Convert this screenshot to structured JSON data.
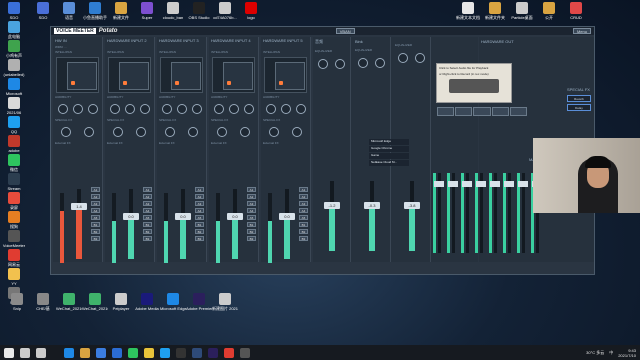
{
  "desktop": {
    "icons_left": [
      {
        "label": "SDO",
        "color": "#3a6fd8"
      },
      {
        "label": "此电脑",
        "color": "#4aa3df"
      },
      {
        "label": "小鸡有声",
        "color": "#3fa34d"
      },
      {
        "label": "(unlabelled)",
        "color": "#b0b0b0"
      },
      {
        "label": "Microsoft",
        "color": "#1e88e5"
      },
      {
        "label": "2021/06",
        "color": "#d9d9d9"
      },
      {
        "label": "QQ",
        "color": "#1ea0f0"
      },
      {
        "label": "adobe",
        "color": "#c0392b"
      },
      {
        "label": "微信",
        "color": "#2ec55f"
      },
      {
        "label": "Stream",
        "color": "#2c3e50"
      },
      {
        "label": "录屏",
        "color": "#e74c3c"
      },
      {
        "label": "搜狗",
        "color": "#e67e22"
      },
      {
        "label": "VoiceMeeter",
        "color": "#555"
      },
      {
        "label": "网易云",
        "color": "#e03c31"
      },
      {
        "label": "YY",
        "color": "#f2c14e"
      },
      {
        "label": "Snip",
        "color": "#777"
      }
    ],
    "icons_top": [
      {
        "label": "SDO",
        "color": "#4a6fd8"
      },
      {
        "label": "语音",
        "color": "#5a8ed8"
      },
      {
        "label": "小鱼直播助手",
        "color": "#2f7dd1"
      },
      {
        "label": "新建文件",
        "color": "#d9a441"
      },
      {
        "label": "Super",
        "color": "#7d4fd0"
      },
      {
        "label": "cloudc_ban",
        "color": "#ccc"
      },
      {
        "label": "OBS Studio",
        "color": "#222"
      },
      {
        "label": "cd74A076b...",
        "color": "#ccc"
      },
      {
        "label": "logo",
        "color": "#d00"
      }
    ],
    "icons_top_right": [
      {
        "label": "新建文本文档",
        "color": "#e6e6e6"
      },
      {
        "label": "新建文件夹",
        "color": "#d9a441"
      },
      {
        "label": "Particle桌面",
        "color": "#ccc"
      },
      {
        "label": "公开",
        "color": "#d9a441"
      },
      {
        "label": "CRUD",
        "color": "#e04848"
      }
    ],
    "icons_bottom": [
      {
        "label": "Snip",
        "color": "#8a8a8a"
      },
      {
        "label": "CHE/基",
        "color": "#888"
      },
      {
        "label": "WeChat_2021052",
        "color": "#3fb36b"
      },
      {
        "label": "WeChat_2021052",
        "color": "#3fb36b"
      },
      {
        "label": "Peiplayer",
        "color": "#ccc"
      },
      {
        "label": "Adobe Media",
        "color": "#1a1a7a"
      },
      {
        "label": "Microsoft Edge",
        "color": "#1e88e5"
      },
      {
        "label": "Adobe Premiere",
        "color": "#2b1f5c"
      },
      {
        "label": "新建图片 2021062",
        "color": "#ccc"
      }
    ]
  },
  "voicemeeter": {
    "logo": "VOICE MEETER",
    "brand": "Potato",
    "vban": "VBAN",
    "strips": [
      {
        "name": "HW IN",
        "sub": "WDM: ...",
        "fader": "1.4",
        "level": 0.75,
        "color": "#e9573c"
      },
      {
        "name": "HARDWARE INPUT 2",
        "sub": "",
        "fader": "0.0",
        "level": 0.6,
        "color": "#4fd6b0"
      },
      {
        "name": "HARDWARE INPUT 3",
        "sub": "",
        "fader": "0.0",
        "level": 0.6,
        "color": "#4fd6b0"
      },
      {
        "name": "HARDWARE INPUT 4",
        "sub": "",
        "fader": "0.0",
        "level": 0.6,
        "color": "#4fd6b0"
      },
      {
        "name": "HARDWARE INPUT 5",
        "sub": "",
        "fader": "0.0",
        "level": 0.6,
        "color": "#4fd6b0"
      }
    ],
    "intellipan_label": "INTELLIPAN",
    "color_panel": "Color Panel",
    "audibility_label": "AUDIBILITY",
    "comp_label": "Comp",
    "gate_label": "Gate",
    "special_fx": "SPECIAL FX",
    "external_fx": "External FX",
    "bus_buttons": [
      "A1",
      "A2",
      "A3",
      "A4",
      "A5",
      "B1",
      "B2",
      "B3"
    ],
    "virtual": [
      {
        "name": "音频",
        "fader": "-1.2"
      },
      {
        "name": "Bink",
        "fader": "-0.3"
      },
      {
        "name": "",
        "fader": "-3.8"
      }
    ],
    "equalizer": "EQUALIZER",
    "ext_fx_list": [
      "Microsoft Edge",
      "Google Chrome",
      "Game",
      "NetEase Cloud M..."
    ],
    "hw_out_title": "HARDWARE OUT",
    "menu": "Menu",
    "cassette_line1": "Click to Select Audio file for Playback",
    "cassette_line2": "or Right-click to Record (in rec mode)",
    "special_fx_title": "SPECIAL FX",
    "reverb": "Reverb",
    "delay": "Delay",
    "master": "MASTER SECTION",
    "bus_fader_values": [
      "0.0",
      "0.0",
      "0.0",
      "0.0",
      "0.0",
      "0.0",
      "0.0",
      "0.0"
    ]
  },
  "taskbar": {
    "pinned": [
      {
        "name": "windows",
        "color": "#e8e8e8"
      },
      {
        "name": "search",
        "color": "#ccc"
      },
      {
        "name": "task-view",
        "color": "#ccc"
      },
      {
        "name": "edge",
        "color": "#1e88e5"
      },
      {
        "name": "explorer",
        "color": "#d9a441"
      },
      {
        "name": "store",
        "color": "#3b7de0"
      },
      {
        "name": "mail",
        "color": "#2b6cd3"
      },
      {
        "name": "wechat",
        "color": "#2ec55f"
      },
      {
        "name": "chrome",
        "color": "#e8c33a"
      },
      {
        "name": "qq",
        "color": "#1ea0f0"
      },
      {
        "name": "obs",
        "color": "#333"
      },
      {
        "name": "voicemeeter",
        "color": "#2e4a78"
      },
      {
        "name": "premiere",
        "color": "#2b1f5c"
      },
      {
        "name": "netease",
        "color": "#e03c31"
      },
      {
        "name": "terminal",
        "color": "#555"
      }
    ],
    "weather": "30°C 多云",
    "time": "9:43",
    "date": "2021/7/10",
    "ime": "中"
  }
}
